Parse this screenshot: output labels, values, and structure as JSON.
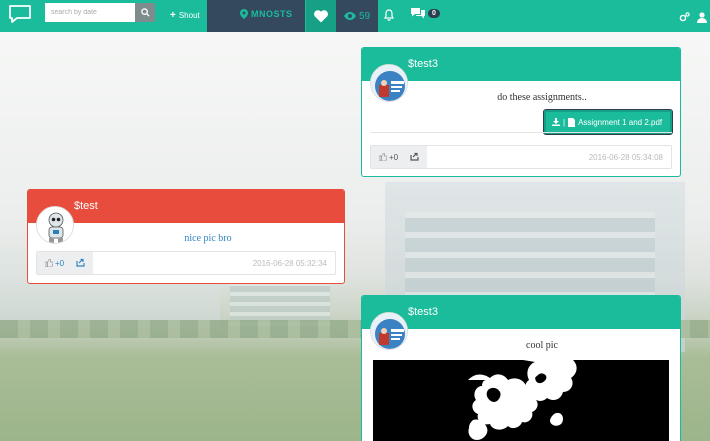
{
  "navbar": {
    "search_placeholder": "search by date",
    "shout_label": "Shout",
    "logo_text": "MNOSTS",
    "view_count": "59",
    "message_badge": "0"
  },
  "posts": [
    {
      "username": "$test3",
      "text": "do these assignments..",
      "attachment_label": "Assignment 1 and 2.pdf",
      "likes": "+0",
      "timestamp": "2016-06-28 05:34:08"
    },
    {
      "username": "$test",
      "text": "nice pic bro",
      "likes": "+0",
      "timestamp": "2016-06-28 05:32:34"
    },
    {
      "username": "$test3",
      "text": "cool pic"
    }
  ],
  "colors": {
    "primary": "#1abc9c",
    "primary_dark": "#16a085",
    "danger": "#e74c3c",
    "navy": "#34495e"
  }
}
